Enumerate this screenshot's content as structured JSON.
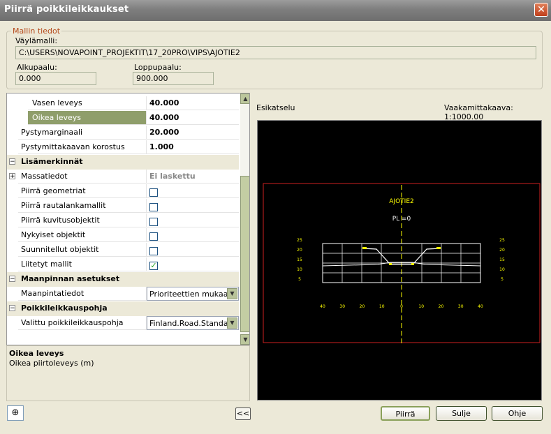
{
  "window": {
    "title": "Piirrä poikkileikkaukset",
    "close": "✕"
  },
  "model": {
    "group_label": "Mallin tiedot",
    "path_label": "Väylämalli:",
    "path_value": "C:\\USERS\\NOVAPOINT_PROJEKTIT\\17_20PRO\\VIPS\\AJOTIE2",
    "start_label": "Alkupaalu:",
    "start_value": "0.000",
    "end_label": "Loppupaalu:",
    "end_value": "900.000"
  },
  "props": {
    "rows": [
      {
        "label": "Vasen leveys",
        "value": "40.000"
      },
      {
        "label": "Oikea leveys",
        "value": "40.000"
      },
      {
        "label": "Pystymarginaali",
        "value": "20.000"
      },
      {
        "label": "Pystymittakaavan korostus",
        "value": "1.000"
      }
    ],
    "cat_lisamerkinnat": "Lisämerkinnät",
    "massatiedot_label": "Massatiedot",
    "massatiedot_value": "Ei laskettu",
    "checks": [
      {
        "label": "Piirrä geometriat",
        "checked": false
      },
      {
        "label": "Piirrä rautalankamallit",
        "checked": false
      },
      {
        "label": "Piirrä kuvitusobjektit",
        "checked": false
      },
      {
        "label": "Nykyiset objektit",
        "checked": false
      },
      {
        "label": "Suunnitellut objektit",
        "checked": false
      },
      {
        "label": "Liitetyt mallit",
        "checked": true
      }
    ],
    "check_mark": "✓",
    "cat_maanpinta": "Maanpinnan asetukset",
    "maanpinta_label": "Maanpintatiedot",
    "maanpinta_value": "Prioriteettien mukaan",
    "cat_pohja": "Poikkileikkauspohja",
    "pohja_label": "Valittu poikkileikkauspohja",
    "pohja_value": "Finland.Road.Standard"
  },
  "description": {
    "title": "Oikea leveys",
    "text": "Oikea piirtoleveys (m)"
  },
  "preview": {
    "label": "Esikatselu",
    "scale": "Vaakamittakaava: 1:1000.00",
    "road_name": "AJOTIE2",
    "station": "PL =0",
    "y_ticks": [
      "25",
      "20",
      "15",
      "10",
      "5"
    ],
    "x_ticks": [
      "40",
      "30",
      "20",
      "10",
      "0",
      "10",
      "20",
      "30",
      "40"
    ]
  },
  "buttons": {
    "collapse": "<<",
    "draw": "Piirrä",
    "close": "Sulje",
    "help": "Ohje"
  },
  "colors": {
    "frame": "#cc1f1f",
    "annotation": "#ffff00",
    "line": "#ffffff",
    "selected": "#8f9e6b"
  }
}
